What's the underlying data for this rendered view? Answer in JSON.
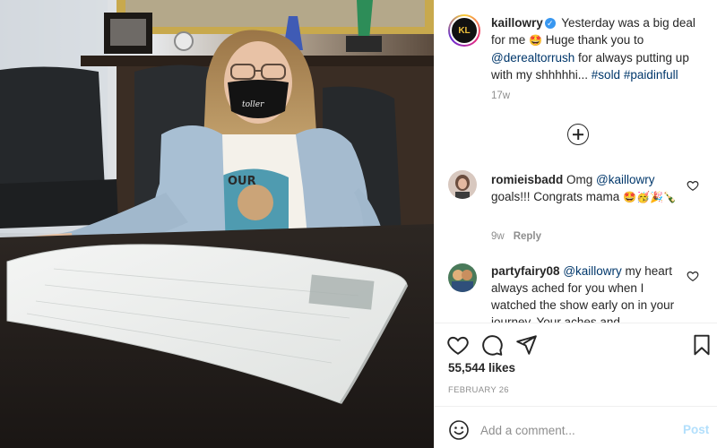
{
  "post": {
    "author": "kaillowry",
    "caption_text_1": " Yesterday was a big deal for me ",
    "caption_emoji_1": "🤩",
    "caption_text_2": " Huge thank you to ",
    "caption_mention": "@derealtorrush",
    "caption_text_3": " for always putting up with my shhhhhi... ",
    "caption_tag_1": "#sold",
    "caption_tag_2": "#paidinfull",
    "caption_time": "17w",
    "avatar_text": "KL",
    "mask_text": "toller"
  },
  "comments": [
    {
      "user": "romieisbadd",
      "text_1": " Omg ",
      "mention": "@kaillowry",
      "text_2": " goals!!! Congrats mama ",
      "emojis": "🤩🥳🎉🍾",
      "time": "9w",
      "reply_label": "Reply"
    },
    {
      "user": "partyfairy08",
      "text_1": " ",
      "mention": "@kaillowry",
      "text_2": " my heart always ached for you when I watched the show early on in your journey. Your aches and"
    }
  ],
  "actions": {
    "likes": "55,544 likes",
    "date": "FEBRUARY 26"
  },
  "composer": {
    "placeholder": "Add a comment...",
    "post_label": "Post"
  },
  "colors": {
    "link": "#00376b",
    "muted": "#8e8e8e",
    "post_button_disabled": "#b2dffc",
    "verified": "#3897f0"
  }
}
